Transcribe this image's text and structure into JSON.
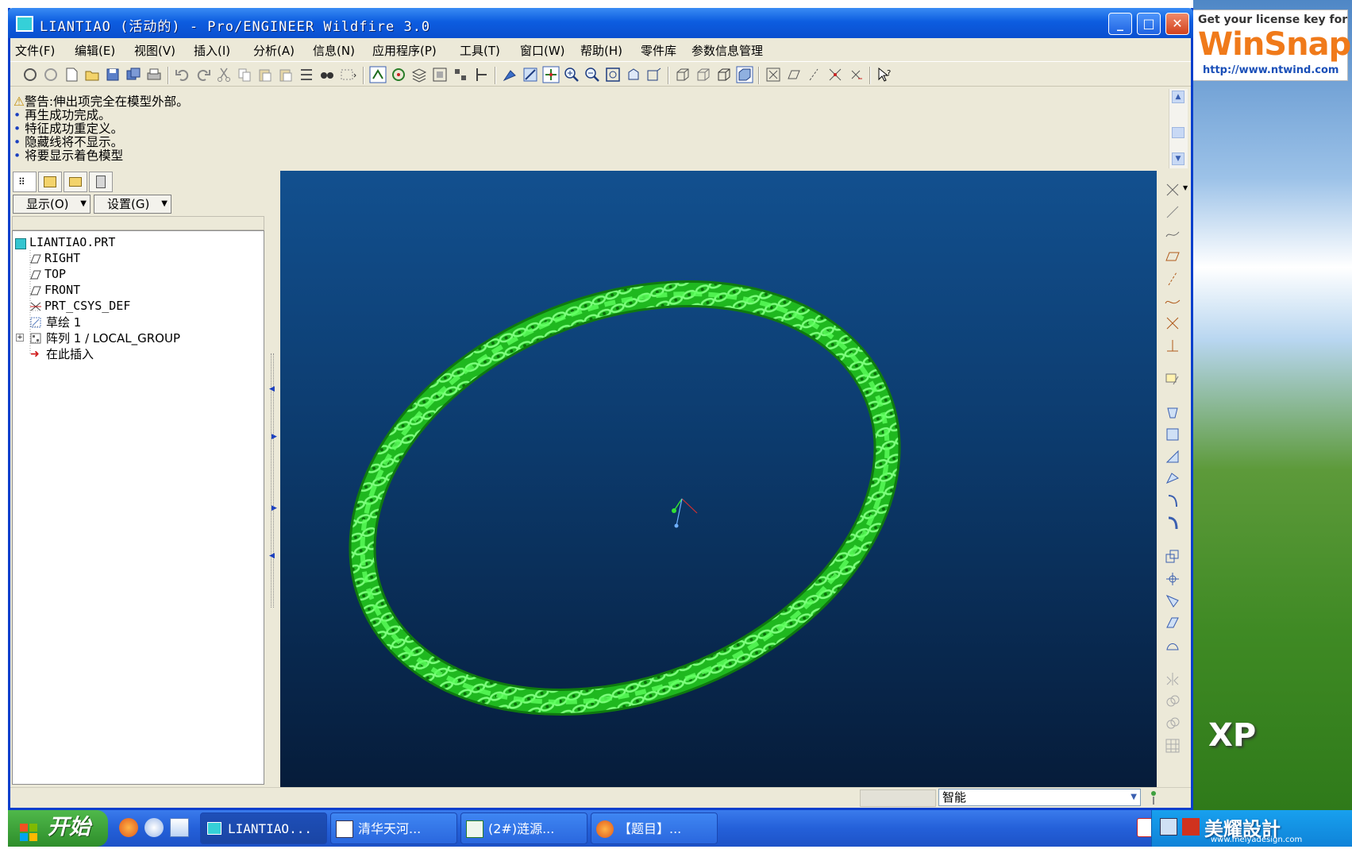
{
  "window": {
    "title": "LIANTIAO (活动的) - Pro/ENGINEER Wildfire 3.0"
  },
  "menu": [
    "文件(F)",
    "编辑(E)",
    "视图(V)",
    "插入(I)",
    "分析(A)",
    "信息(N)",
    "应用程序(P)",
    "工具(T)",
    "窗口(W)",
    "帮助(H)",
    "零件库",
    "参数信息管理"
  ],
  "messages": [
    "警告:伸出项完全在模型外部。",
    "再生成功完成。",
    "特征成功重定义。",
    "隐藏线将不显示。",
    "将要显示着色模型"
  ],
  "left_panel": {
    "show_label": "显示(O)",
    "settings_label": "设置(G)",
    "tree": [
      {
        "label": "LIANTIAO.PRT",
        "icon": "part-icon"
      },
      {
        "label": "RIGHT",
        "icon": "datum-plane-icon"
      },
      {
        "label": "TOP",
        "icon": "datum-plane-icon"
      },
      {
        "label": "FRONT",
        "icon": "datum-plane-icon"
      },
      {
        "label": "PRT_CSYS_DEF",
        "icon": "csys-icon"
      },
      {
        "label": "草绘 1",
        "icon": "sketch-icon"
      },
      {
        "label": "阵列 1 / LOCAL_GROUP",
        "icon": "pattern-icon"
      },
      {
        "label": "在此插入",
        "icon": "insert-here-icon"
      }
    ]
  },
  "status": {
    "filter": "智能"
  },
  "desktop": {
    "winsnap_line1": "Get your license key for",
    "winsnap_logo": "WinSnap",
    "winsnap_url": "http://www.ntwind.com",
    "xp_label": "XP",
    "watermark": "美耀設計",
    "watermark_url": "www.meiyadesign.com"
  },
  "taskbar": {
    "start": "开始",
    "tasks": [
      "LIANTIAO...",
      "清华天河...",
      "(2#)涟源...",
      "【题目】..."
    ]
  },
  "colors": {
    "chain": "#2ee82e",
    "viewport_top": "#12508f",
    "viewport_bottom": "#061c3a",
    "titlebar": "#0d5de0"
  }
}
